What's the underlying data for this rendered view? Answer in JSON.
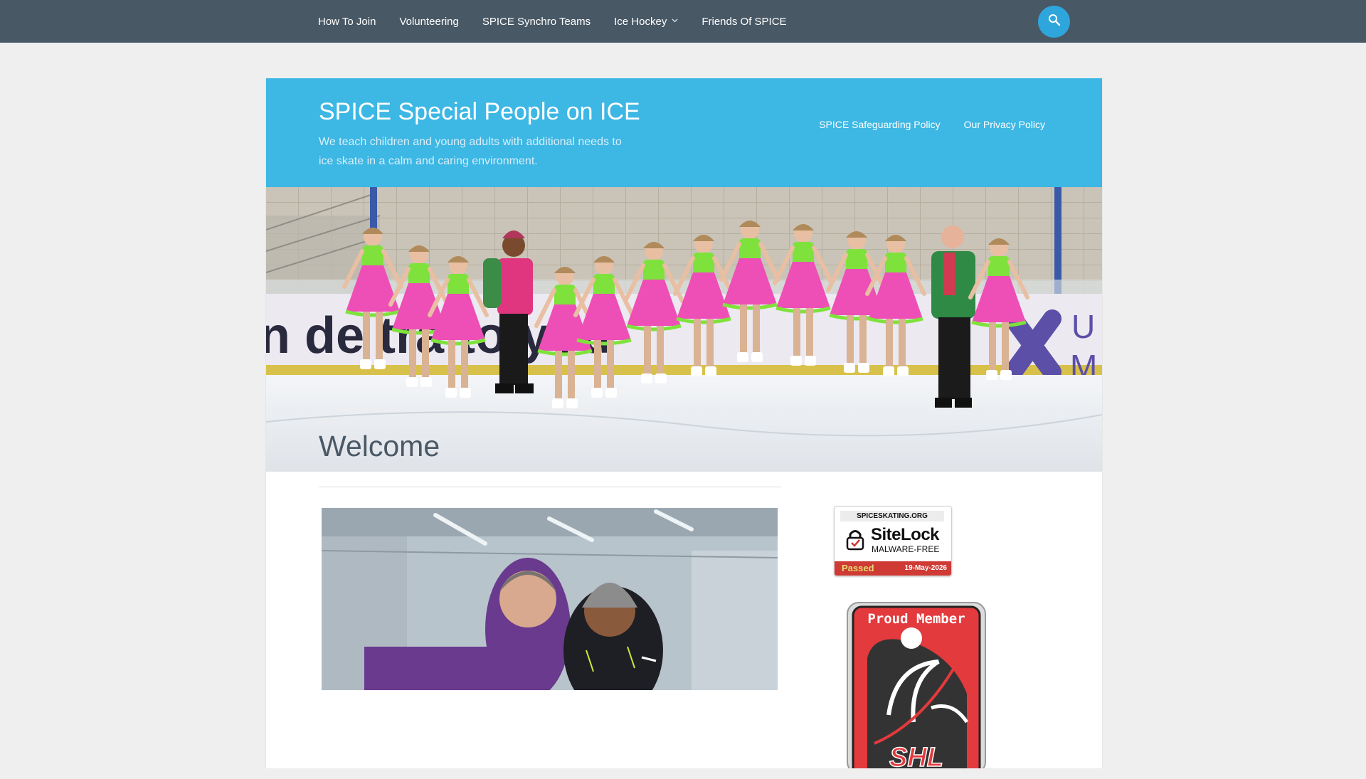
{
  "topnav": {
    "items": [
      {
        "label": "How To Join"
      },
      {
        "label": "Volunteering"
      },
      {
        "label": "SPICE Synchro Teams"
      },
      {
        "label": "Ice Hockey",
        "has_dropdown": true
      },
      {
        "label": "Friends Of SPICE"
      }
    ],
    "search_icon": "search-icon"
  },
  "header": {
    "site_title": "SPICE Special People on ICE",
    "site_description": "We teach children and young adults with additional needs to ice skate in a calm and caring environment.",
    "links": [
      {
        "label": "SPICE Safeguarding Policy"
      },
      {
        "label": "Our Privacy Policy"
      }
    ]
  },
  "hero": {
    "banner_text": "n de   tra     to you",
    "banner_side_letters": "U M"
  },
  "main": {
    "page_title": "Welcome"
  },
  "sidebar": {
    "sitelock": {
      "domain": "SPICESKATING.ORG",
      "brand": "SiteLock",
      "subtitle": "MALWARE-FREE",
      "status": "Passed",
      "date": "19-May-2026"
    },
    "member_badge": {
      "text": "Proud Member",
      "logo_letters": "SHL"
    }
  },
  "colors": {
    "topbar": "#485865",
    "header_blue": "#3db7e4",
    "search_button": "#2ea6dc",
    "page_background": "#efefef",
    "costume_pink": "#ee4fb6",
    "costume_green": "#7fe23c",
    "sitelock_red": "#cf3a35"
  }
}
